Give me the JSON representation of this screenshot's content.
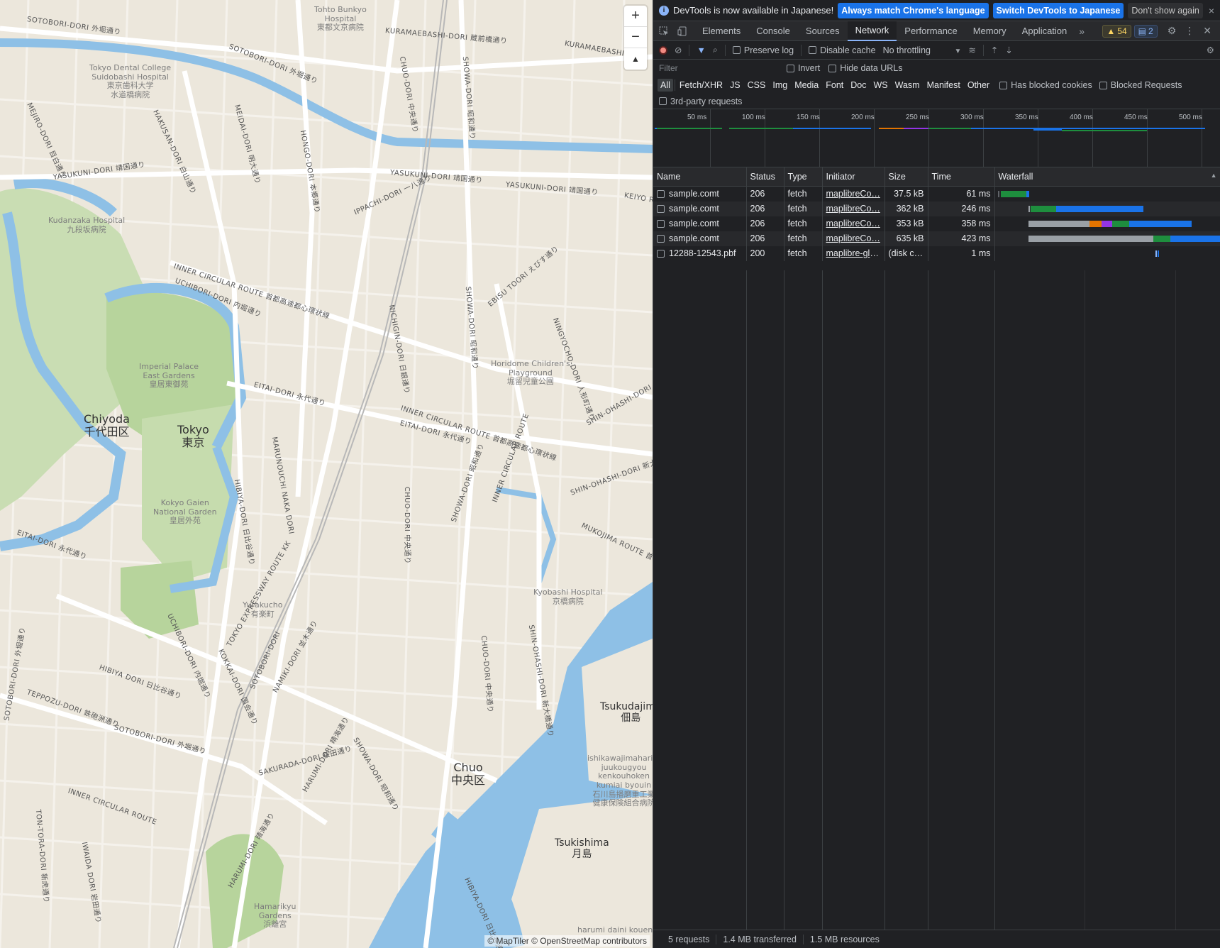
{
  "map": {
    "places": [
      {
        "en": "Chiyoda",
        "ja": "千代田区"
      },
      {
        "en": "Tokyo",
        "ja": "東京"
      },
      {
        "en": "Chuo",
        "ja": "中央区"
      },
      {
        "en": "Tsukudajima",
        "ja": "佃島"
      },
      {
        "en": "Tsukishima",
        "ja": "月島"
      }
    ],
    "pois": [
      {
        "lines": [
          "Tohto Bunkyo",
          "Hospital",
          "東都文京病院"
        ]
      },
      {
        "lines": [
          "Tokyo Dental College",
          "Suidobashi Hospital",
          "東京歯科大学",
          "水道橋病院"
        ]
      },
      {
        "lines": [
          "Kudanzaka Hospital",
          "九段坂病院"
        ]
      },
      {
        "lines": [
          "Imperial Palace",
          "East Gardens",
          "皇居東御苑"
        ]
      },
      {
        "lines": [
          "Kokyo Gaien",
          "National Garden",
          "皇居外苑"
        ]
      },
      {
        "lines": [
          "Horidome Children's",
          "Playground",
          "堀留児童公園"
        ]
      },
      {
        "lines": [
          "Kyobashi Hospital",
          "京橋病院"
        ]
      },
      {
        "lines": [
          "Yurakucho",
          "有楽町"
        ]
      },
      {
        "lines": [
          "Hamarikyu",
          "Gardens",
          "浜離宮"
        ]
      },
      {
        "lines": [
          "ishikawajimaharim",
          "juukougyou",
          "kenkouhoken",
          "kumiai byouin",
          "石川島播磨重工業",
          "健康保険組合病院"
        ]
      },
      {
        "lines": [
          "harumi daini kouen"
        ]
      }
    ],
    "roads": [
      "SOTOBORI-DORI 外堀通り",
      "KURAMAEBASHI-DORI 蔵前橋通り",
      "KURAMAEBASHI-DO",
      "SOTOBORI-DORI 外堀通り",
      "CHUO-DORI 中央通り",
      "SHOWA-DORI 昭和通り",
      "MEJIRO-DORI 目白通り",
      "HAKUSAN-DORI 白山通り",
      "MEIDAI-DORI 明大通り",
      "HONGO-DORI 本郷通り",
      "YASUKUNI-DORI 靖国通り",
      "YASUKUNI-DORI 靖国通り",
      "YASUKUNI-DORI 靖国通り",
      "IPPACHI-DORI 一八通り",
      "KEIYO R",
      "INNER CIRCULAR ROUTE 首都高速都心環状線",
      "UCHIBORI-DORI 内堀通り",
      "EBISU TOORI えびす通り",
      "NICHIGIN-DORI 日銀通り",
      "SHOWA-DORI 昭和通り",
      "NINGYOCHO-DORI 人形町通り",
      "EITAI-DORI 永代通り",
      "INNER CIRCULAR ROUTE 首都高速都心環状線",
      "SHIN-OHASHI-DORI",
      "EITAI-DORI 永代通り",
      "MARUNOUCHI NAKA DORI",
      "HIBIYA-DORI 日比谷通り",
      "CHUO-DORI 中央通り",
      "SHOWA-DORI 昭和通り",
      "INNER CIRCULAR ROUTE",
      "SHIN-OHASHI-DORI 新大橋通り",
      "MUKOJIMA ROUTE 首都高速6号向島線",
      "EITAI-DORI 永代通り",
      "UCHIBORI-DORI 内堀通り",
      "HIBIYA DORI 日比谷通り",
      "KOKKAI-DORI 国会通り",
      "TOKYO EXPRESSWAY ROUTE KK",
      "SOTOBORI-DORI",
      "NAMIKI-DORI 並木通り",
      "CHUO-DORI 中央通り",
      "SHIN-OHASHI-DORI 新大橋通り",
      "TEPPOZU-DORI 鉄砲洲通り",
      "SOTOBORI-DORI 外堀通り",
      "SOTOBORI-DORI 外堀通り",
      "SAKURADA-DORI 桜田通り",
      "SHOWA-DORI 昭和通り",
      "HARUMI-DORI 晴海通り",
      "INNER CIRCULAR ROUTE",
      "TON-TORA-DORI 新虎通り",
      "IWAIDA DORI 岩田通り",
      "HIBIYA-DORI 日比谷通り",
      "HARUMI-DORI 晴海通り",
      "首都高速都心環状線"
    ],
    "zoom_in": "+",
    "zoom_out": "−",
    "compass": "▲",
    "attribution": "© MapTiler © OpenStreetMap contributors",
    "colors": {
      "land": "#ece7dc",
      "water": "#8ec0e6",
      "park": "#b7d49c",
      "road": "#ffffff"
    }
  },
  "devtools": {
    "infobar": {
      "message": "DevTools is now available in Japanese!",
      "btn_match": "Always match Chrome's language",
      "btn_switch": "Switch DevTools to Japanese",
      "btn_dismiss": "Don't show again",
      "close": "×"
    },
    "tabs": [
      "Elements",
      "Console",
      "Sources",
      "Network",
      "Performance",
      "Memory",
      "Application"
    ],
    "active_tab": "Network",
    "more_tabs": "»",
    "warnings": "54",
    "messages": "2",
    "toolbar": {
      "preserve_log": "Preserve log",
      "disable_cache": "Disable cache",
      "throttling": "No throttling"
    },
    "filter": {
      "placeholder": "Filter",
      "invert": "Invert",
      "hide_data_urls": "Hide data URLs"
    },
    "types": [
      "All",
      "Fetch/XHR",
      "JS",
      "CSS",
      "Img",
      "Media",
      "Font",
      "Doc",
      "WS",
      "Wasm",
      "Manifest",
      "Other"
    ],
    "has_blocked_cookies": "Has blocked cookies",
    "blocked_requests": "Blocked Requests",
    "third_party": "3rd-party requests",
    "overview_ticks": [
      "50 ms",
      "100 ms",
      "150 ms",
      "200 ms",
      "250 ms",
      "300 ms",
      "350 ms",
      "400 ms",
      "450 ms",
      "500 ms"
    ],
    "columns": [
      "Name",
      "Status",
      "Type",
      "Initiator",
      "Size",
      "Time",
      "Waterfall"
    ],
    "rows": [
      {
        "name": "sample.comt",
        "status": "206",
        "type": "fetch",
        "initiator": "maplibreCo…",
        "size": "37.5 kB",
        "time": "61 ms"
      },
      {
        "name": "sample.comt",
        "status": "206",
        "type": "fetch",
        "initiator": "maplibreCo…",
        "size": "362 kB",
        "time": "246 ms"
      },
      {
        "name": "sample.comt",
        "status": "206",
        "type": "fetch",
        "initiator": "maplibreCo…",
        "size": "353 kB",
        "time": "358 ms"
      },
      {
        "name": "sample.comt",
        "status": "206",
        "type": "fetch",
        "initiator": "maplibreCo…",
        "size": "635 kB",
        "time": "423 ms"
      },
      {
        "name": "12288-12543.pbf",
        "status": "200",
        "type": "fetch",
        "initiator": "maplibre-gl.j…",
        "size": "(disk c…",
        "time": "1 ms"
      }
    ],
    "status_bar": {
      "requests": "5 requests",
      "transferred": "1.4 MB transferred",
      "resources": "1.5 MB resources"
    }
  }
}
